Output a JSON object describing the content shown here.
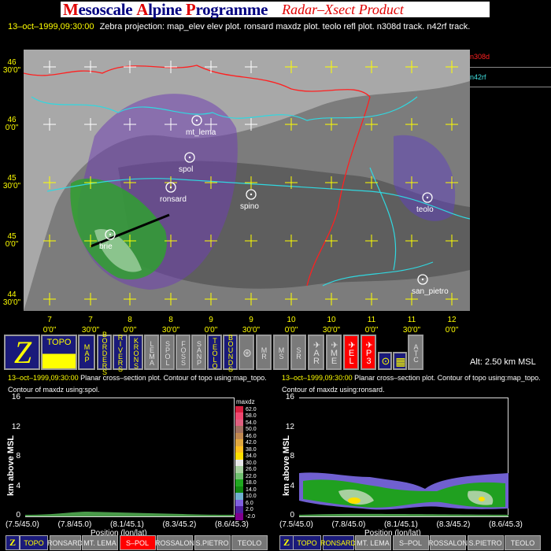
{
  "banner": {
    "title_parts": [
      {
        "cap": "M",
        "rest": "esoscale "
      },
      {
        "cap": "A",
        "rest": "lpine "
      },
      {
        "cap": "P",
        "rest": "rogramme"
      }
    ],
    "product": "Radar–Xsect Product"
  },
  "header": {
    "timestamp": "13–oct–1999,09:30:00",
    "description": "Zebra projection: map_elev elev plot.  ronsard maxdz  plot.  teolo refl  plot.   n308d track.   n42rf track."
  },
  "map": {
    "tracks": [
      {
        "name": "n308d",
        "color": "#ff2020"
      },
      {
        "name": "n42rf",
        "color": "#40e0e0"
      }
    ],
    "lat_labels": [
      [
        "46",
        "30'0\""
      ],
      [
        "46",
        "0'0\""
      ],
      [
        "45",
        "30'0\""
      ],
      [
        "45",
        "0'0\""
      ],
      [
        "44",
        "30'0\""
      ]
    ],
    "lon_labels": [
      [
        "7",
        "0'0\""
      ],
      [
        "7",
        "30'0\""
      ],
      [
        "8",
        "0'0\""
      ],
      [
        "8",
        "30'0\""
      ],
      [
        "9",
        "0'0\""
      ],
      [
        "9",
        "30'0\""
      ],
      [
        "10",
        "0'0\""
      ],
      [
        "10",
        "30'0\""
      ],
      [
        "11",
        "0'0\""
      ],
      [
        "11",
        "30'0\""
      ],
      [
        "12",
        "0'0\""
      ]
    ],
    "stations": [
      "mt_lema",
      "spol",
      "ronsard",
      "spino",
      "teolo",
      "brie",
      "san_pietro"
    ]
  },
  "toolbar": {
    "z": "Z",
    "topo": "TOPO",
    "map": "MAP",
    "borders": "BORDERS",
    "rivers": "RIVERS",
    "krons": "KRONS",
    "lema": "LEMA",
    "spol": "SPOL",
    "foss": "FOSS",
    "sanp": "SANP",
    "teolo": "TEOLO",
    "bounds": "BOUNDS",
    "mr": "MR",
    "ms": "MS",
    "sr": "SR",
    "ar": "AR",
    "me": "ME",
    "el": "EL",
    "p3": "P3",
    "atc": "ATC",
    "altitude": "Alt: 2.50 km MSL"
  },
  "left_panel": {
    "timestamp": "13–oct–1999,09:30:00",
    "line1": "Planar cross–section plot.  Contour of topo using:map_topo.",
    "line2": "Contour of maxdz using:spol.",
    "ylabel": "km above MSL",
    "yticks": [
      "16",
      "12",
      "8",
      "4",
      "0"
    ],
    "xticks": [
      "(7.5/45.0)",
      "(7.8/45.0)",
      "(8.1/45.1)",
      "(8.3/45.2)",
      "(8.6/45.3)"
    ],
    "xlabel": "Position (lon/lat)",
    "colorbar": {
      "title": "maxdz",
      "levels": [
        "62.0",
        "58.0",
        "54.0",
        "50.0",
        "46.0",
        "42.0",
        "38.0",
        "34.0",
        "30.0",
        "26.0",
        "22.0",
        "18.0",
        "14.0",
        "10.0",
        "6.0",
        "2.0",
        "-2.0"
      ],
      "colors": [
        "#d82040",
        "#f04870",
        "#e06080",
        "#a07060",
        "#c08850",
        "#e0a840",
        "#ffc020",
        "#ffe000",
        "#e8e8e8",
        "#a8d0a0",
        "#70c070",
        "#20a820",
        "#108810",
        "#70b0d0",
        "#8060e0",
        "#5020a0",
        "#800090"
      ]
    }
  },
  "right_panel": {
    "timestamp": "13–oct–1999,09:30:00",
    "line1": "Planar cross–section plot.  Contour of topo using:map_topo.",
    "line2": "Contour of maxdz using:ronsard.",
    "ylabel": "km above MSL",
    "yticks": [
      "16",
      "12",
      "8",
      "4",
      "0"
    ],
    "xticks": [
      "(7.5/45.0)",
      "(7.8/45.0)",
      "(8.1/45.1)",
      "(8.3/45.2)",
      "(8.6/45.3)"
    ],
    "xlabel": "Position (lon/lat)"
  },
  "bottom_left": {
    "z": "Z",
    "buttons": [
      "TOPO",
      "RONSARD",
      "MT. LEMA",
      "S–POL",
      "ROSSALON",
      "S.PIETRO",
      "TEOLO"
    ]
  },
  "bottom_right": {
    "z": "Z",
    "buttons": [
      "TOPO",
      "RONSARD",
      "MT. LEMA",
      "S–POL",
      "ROSSALON",
      "S.PIETRO",
      "TEOLO"
    ]
  }
}
